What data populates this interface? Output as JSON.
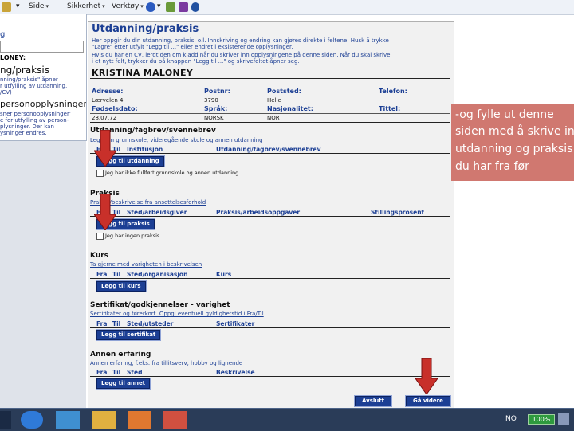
{
  "toolbar": {
    "items": [
      {
        "label": "Side",
        "x": "side"
      },
      {
        "label": "Sikkerhet"
      },
      {
        "label": "Verktøy"
      }
    ]
  },
  "left_panel": {
    "label_1": "g",
    "label_2": "LONEY:",
    "heading_1": "ng/praksis",
    "text_1": [
      "nning/praksis\" åpner",
      "r utfylling av utdanning,",
      "/CV)"
    ],
    "heading_2": "personopplysninger",
    "text_2": [
      "sner personopplysninger'",
      "e for utfylling av person-",
      "plysninger. Der kan",
      "ysninger endres."
    ]
  },
  "form": {
    "title": "Utdanning/praksis",
    "intro": [
      "Her oppgir du din utdanning, praksis, o.l. Innskriving og endring kan gjøres direkte i feltene. Husk å trykke",
      "\"Lagre\" etter utfylt \"Legg til ...\" eller endret i eksisterende opplysninger.",
      "Hvis du har en CV, lerdt den om kladd når du skriver inn opplysningene på denne siden. Når du skal skrive",
      "i et nytt felt, trykker du på knappen \"Legg til ...\" og skrivefeltet åpner seg."
    ],
    "person_name": "KRISTINA MALONEY",
    "fields_row1": {
      "address_label": "Adresse:",
      "address_value": "Lærvelen 4",
      "postno_label": "Postnr:",
      "postno_value": "3790",
      "poststed_label": "Poststed:",
      "poststed_value": "Helle",
      "phone_label": "Telefon:",
      "phone_value": ""
    },
    "fields_row2": {
      "birth_label": "Fødselsdato:",
      "birth_value": "28.07.72",
      "lang_label": "Språk:",
      "lang_value": "NORSK",
      "nat_label": "Nasjonalitet:",
      "nat_value": "NOR",
      "title_label": "Tittel:",
      "title_value": ""
    },
    "sections": {
      "edu": {
        "heading": "Utdanning/fagbrev/svennebrev",
        "sub": "Legg inn grunnskole, videregående skole og annen utdanning",
        "col_fra": "Fra",
        "col_til": "Til",
        "col_inst": "Institusjon",
        "col_edu": "Utdanning/fagbrev/svennebrev",
        "button": "Legg til utdanning",
        "checkbox": "Jeg har ikke fullført grunnskole og annen utdanning."
      },
      "prac": {
        "heading": "Praksis",
        "sub": "Praksis/beskrivelse fra ansettelsesforhold",
        "col_fra": "Fra",
        "col_til": "Til",
        "col_place": "Sted/arbeidsgiver",
        "col_task": "Praksis/arbeidsoppgaver",
        "col_pct": "Stillingsprosent",
        "button": "Legg til praksis",
        "checkbox": "Jeg har ingen praksis."
      },
      "course": {
        "heading": "Kurs",
        "sub": "Ta gjerne med varigheten i beskrivelsen",
        "col_fra": "Fra",
        "col_til": "Til",
        "col_place": "Sted/organisasjon",
        "col_course": "Kurs",
        "button": "Legg til kurs"
      },
      "cert": {
        "heading": "Sertifikat/godkjennelser - varighet",
        "sub": "Sertifikater og førerkort. Oppgi eventuell gyldighetstid i Fra/Til",
        "col_fra": "Fra",
        "col_til": "Til",
        "col_place": "Sted/utsteder",
        "col_cert": "Sertifikater",
        "button": "Legg til sertifikat"
      },
      "other": {
        "heading": "Annen erfaring",
        "sub": "Annen erfaring, f.eks. fra tillitsverv, hobby og lignende",
        "col_fra": "Fra",
        "col_til": "Til",
        "col_place": "Sted",
        "col_desc": "Beskrivelse",
        "button": "Legg til annet"
      }
    },
    "btn_cancel": "Avslutt",
    "btn_next": "Gå videre"
  },
  "callout": {
    "lines": [
      "-og fylle ut denne",
      "siden med å skrive in",
      "utdanning og praksis",
      "du har fra før"
    ]
  },
  "taskbar": {
    "lang": "NO",
    "battery": "100%"
  },
  "colors": {
    "accent": "#1c3f94",
    "arrow": "#c8302a",
    "callout": "#d07870",
    "taskbar": "#2a3c58"
  }
}
